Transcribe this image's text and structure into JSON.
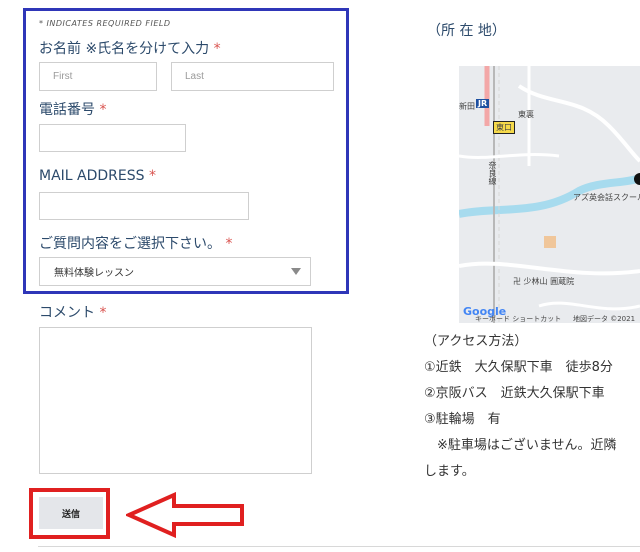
{
  "form": {
    "required_note": "* INDICATES REQUIRED FIELD",
    "name_label": "お名前 ※氏名を分けて入力",
    "first_placeholder": "First",
    "last_placeholder": "Last",
    "phone_label": "電話番号",
    "email_label": "MAIL ADDRESS",
    "inquiry_label": "ご質問内容をご選択下さい。",
    "inquiry_selected": "無料体験レッスン",
    "comment_label": "コメント",
    "required_mark": "*",
    "submit_label": "送信"
  },
  "location": {
    "heading": "（所 在 地）",
    "access_heading": "（アクセス方法）",
    "access_items": [
      "①近鉄　大久保駅下車　徒歩8分",
      "②京阪バス　近鉄大久保駅下車",
      "③駐輪場　有",
      "　※駐車場はございません。近隣",
      "します。"
    ]
  },
  "map": {
    "station": "新田",
    "jr": "JR",
    "exit": "東口",
    "area": "東裏",
    "road": "奈良線",
    "poi": "アズ英会話スクール",
    "temple": "少林山 圓蔵院",
    "google": "Google",
    "shortcuts": "キーボード ショートカット",
    "attribution": "地図データ ©2021"
  },
  "colors": {
    "highlight_box": "#2f36b8",
    "submit_highlight": "#e02020",
    "required": "#d9534f",
    "label": "#2c4a6b"
  }
}
